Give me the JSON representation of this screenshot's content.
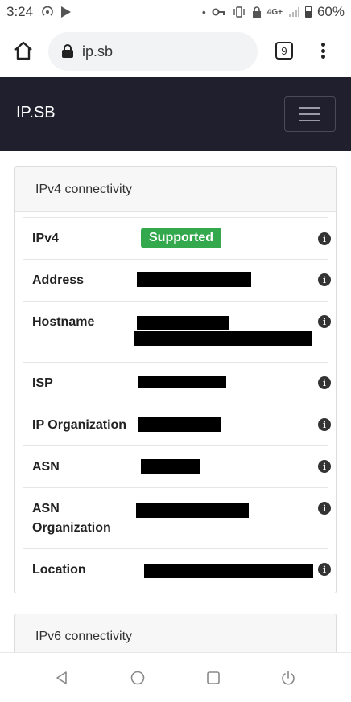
{
  "status_bar": {
    "time": "3:24",
    "network": "4G+",
    "battery": "60%"
  },
  "browser": {
    "url": "ip.sb",
    "tab_count": "9"
  },
  "navbar": {
    "brand": "IP.SB"
  },
  "ipv4_card": {
    "title": "IPv4 connectivity",
    "rows": [
      {
        "label": "IPv4",
        "value": "Supported"
      },
      {
        "label": "Address"
      },
      {
        "label": "Hostname"
      },
      {
        "label": "ISP"
      },
      {
        "label": "IP Organization"
      },
      {
        "label": "ASN"
      },
      {
        "label": "ASN Organization"
      },
      {
        "label": "Location"
      }
    ],
    "info_glyph": "i",
    "badge_color": "#33a84d"
  },
  "ipv6_card": {
    "title": "IPv6 connectivity"
  },
  "colors": {
    "navbar_bg": "#1f1f2e",
    "urlbar_bg": "#f1f3f4"
  }
}
